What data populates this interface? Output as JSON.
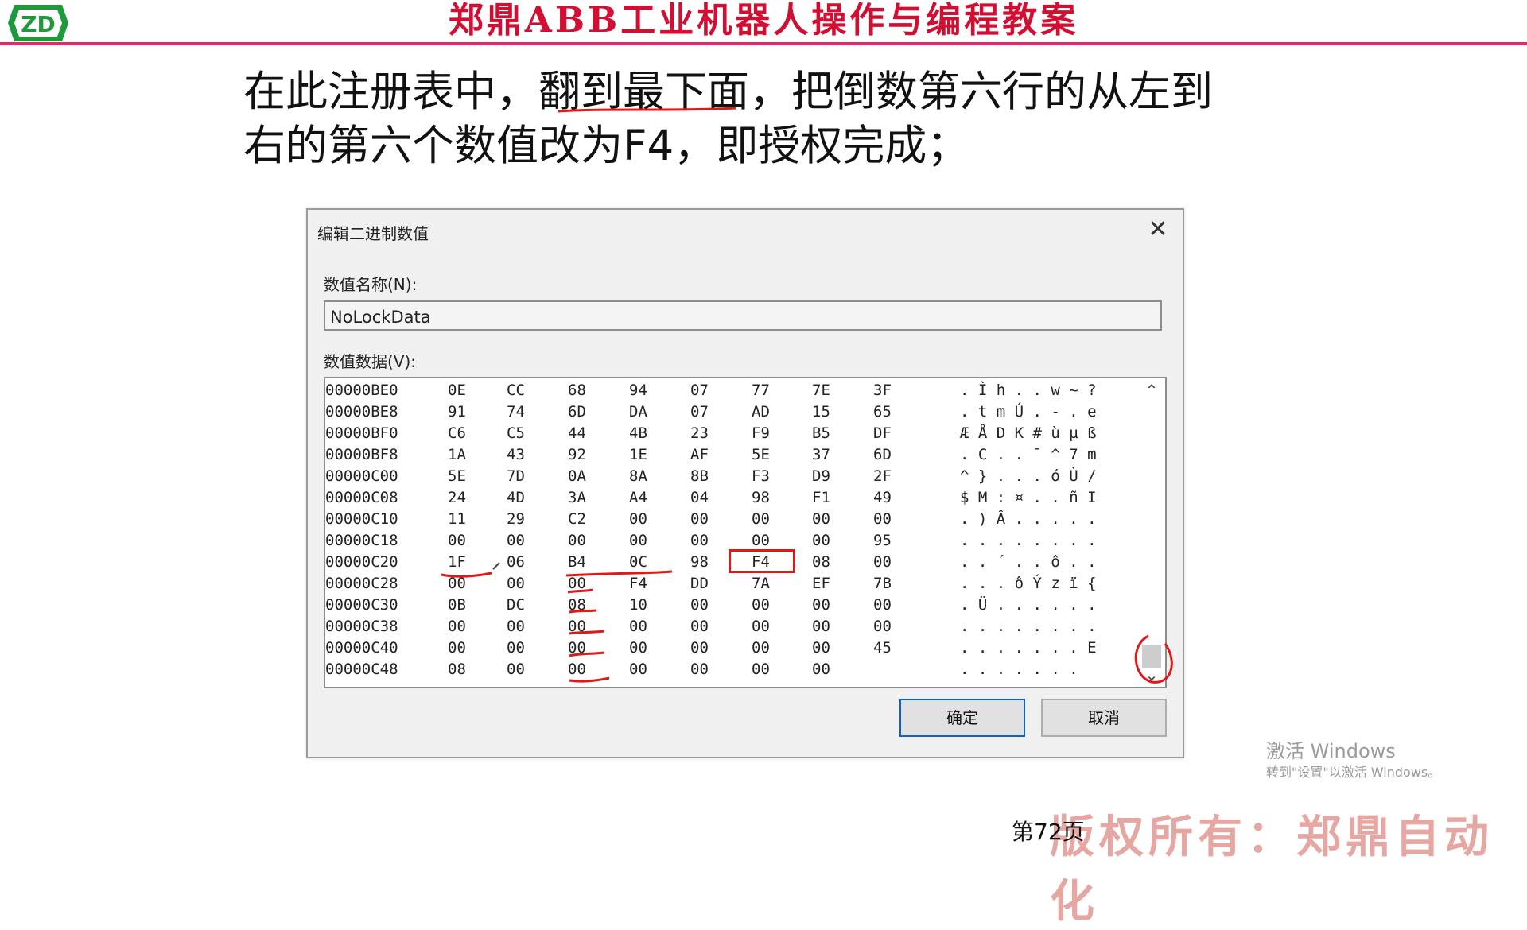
{
  "header": {
    "title": "郑鼎ABB工业机器人操作与编程教案",
    "accent_color": "#d20f32",
    "rule_color": "#e02b68",
    "logo_icon": "zd-logo-icon"
  },
  "instruction": {
    "line1": "在此注册表中，翻到最下面，把倒数第六行的从左到",
    "line2": "右的第六个数值改为F4，即授权完成；"
  },
  "dialog": {
    "title": "编辑二进制数值",
    "close_icon": "close-icon",
    "name_label": "数值名称(N):",
    "name_value": "NoLockData",
    "data_label": "数值数据(V):",
    "ok_label": "确定",
    "cancel_label": "取消",
    "rows": [
      {
        "addr": "00000BE0",
        "bytes": [
          "0E",
          "CC",
          "68",
          "94",
          "07",
          "77",
          "7E",
          "3F"
        ],
        "ascii": ". Ì h . . w ~ ?"
      },
      {
        "addr": "00000BE8",
        "bytes": [
          "91",
          "74",
          "6D",
          "DA",
          "07",
          "AD",
          "15",
          "65"
        ],
        "ascii": ". t m Ú . - . e"
      },
      {
        "addr": "00000BF0",
        "bytes": [
          "C6",
          "C5",
          "44",
          "4B",
          "23",
          "F9",
          "B5",
          "DF"
        ],
        "ascii": "Æ Å D K # ù µ ß"
      },
      {
        "addr": "00000BF8",
        "bytes": [
          "1A",
          "43",
          "92",
          "1E",
          "AF",
          "5E",
          "37",
          "6D"
        ],
        "ascii": ". C . . ¯ ^ 7 m"
      },
      {
        "addr": "00000C00",
        "bytes": [
          "5E",
          "7D",
          "0A",
          "8A",
          "8B",
          "F3",
          "D9",
          "2F"
        ],
        "ascii": "^ } . . . ó Ù /"
      },
      {
        "addr": "00000C08",
        "bytes": [
          "24",
          "4D",
          "3A",
          "A4",
          "04",
          "98",
          "F1",
          "49"
        ],
        "ascii": "$ M : ¤ . . ñ I"
      },
      {
        "addr": "00000C10",
        "bytes": [
          "11",
          "29",
          "C2",
          "00",
          "00",
          "00",
          "00",
          "00"
        ],
        "ascii": ". ) Â . . . . ."
      },
      {
        "addr": "00000C18",
        "bytes": [
          "00",
          "00",
          "00",
          "00",
          "00",
          "00",
          "00",
          "95"
        ],
        "ascii": ". . . . . . . ."
      },
      {
        "addr": "00000C20",
        "bytes": [
          "1F",
          "06",
          "B4",
          "0C",
          "98",
          "F4",
          "08",
          "00"
        ],
        "ascii": ". . ´ . . ô . ."
      },
      {
        "addr": "00000C28",
        "bytes": [
          "00",
          "00",
          "00",
          "F4",
          "DD",
          "7A",
          "EF",
          "7B"
        ],
        "ascii": ". . . ô Ý z ï {"
      },
      {
        "addr": "00000C30",
        "bytes": [
          "0B",
          "DC",
          "08",
          "10",
          "00",
          "00",
          "00",
          "00"
        ],
        "ascii": ". Ü . . . . . ."
      },
      {
        "addr": "00000C38",
        "bytes": [
          "00",
          "00",
          "00",
          "00",
          "00",
          "00",
          "00",
          "00"
        ],
        "ascii": ". . . . . . . ."
      },
      {
        "addr": "00000C40",
        "bytes": [
          "00",
          "00",
          "00",
          "00",
          "00",
          "00",
          "00",
          "45"
        ],
        "ascii": ". . . . . . . E"
      },
      {
        "addr": "00000C48",
        "bytes": [
          "08",
          "00",
          "00",
          "00",
          "00",
          "00",
          "00",
          ""
        ],
        "ascii": ". . . . . . ."
      }
    ]
  },
  "watermark": {
    "activate_line1": "激活 Windows",
    "activate_line2": "转到\"设置\"以激活 Windows。"
  },
  "footer": {
    "page_number": "第72页",
    "copyright": "版权所有：郑鼎自动化"
  }
}
